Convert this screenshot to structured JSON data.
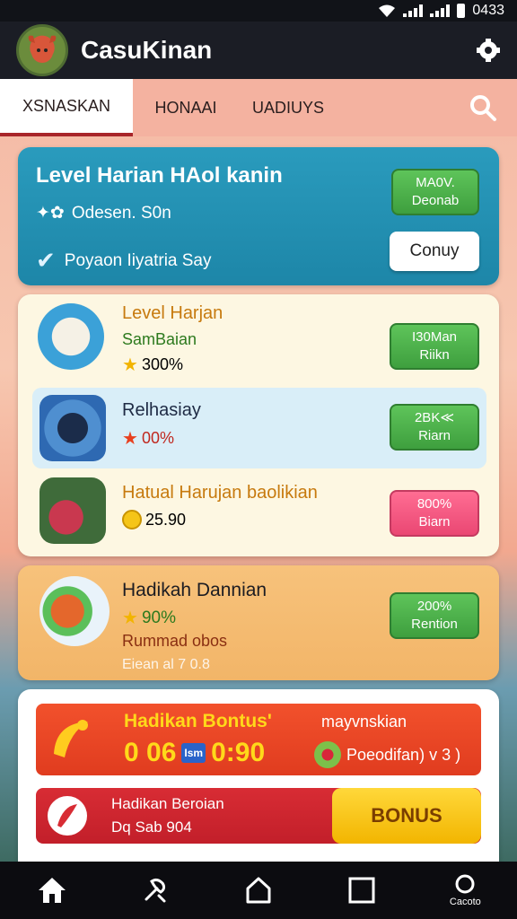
{
  "status_bar": {
    "time": "0433"
  },
  "app_bar": {
    "title": "CasuKinan",
    "avatar_icon": "crab-avatar",
    "settings_icon": "gear-icon"
  },
  "tabs": [
    {
      "label": "XSNASKAN",
      "active": true
    },
    {
      "label": "HONAAI",
      "active": false
    },
    {
      "label": "UADIUYS",
      "active": false
    }
  ],
  "hero": {
    "title": "Level Harian HAol kanin",
    "subtitle": "Odesen. S0n",
    "check_text": "Poyaon Iiyatria Say",
    "primary_button": {
      "line1": "MA0V.",
      "line2": "Deonab"
    },
    "secondary_button": "Conuy",
    "colors": {
      "background": "#1d86a8",
      "button_green": "#3e9f3e"
    }
  },
  "list_items": [
    {
      "title": "Level Harjan",
      "subtitle": "SamBaian",
      "stat": "300%",
      "stat_icon": "star-icon",
      "button": {
        "line1": "I30Man",
        "line2": "Riikn"
      },
      "button_color": "green",
      "highlighted": false
    },
    {
      "title": "Relhasiay",
      "subtitle": "",
      "stat": "00%",
      "stat_icon": "star-icon",
      "button": {
        "line1": "2BK≪",
        "line2": "Riarn"
      },
      "button_color": "green",
      "highlighted": true
    },
    {
      "title": "Hatual Harujan baolikian",
      "subtitle": "",
      "stat": "25.90",
      "stat_icon": "coin-icon",
      "button": {
        "line1": "800%",
        "line2": "Biarn"
      },
      "button_color": "pink",
      "highlighted": false
    }
  ],
  "feature_card": {
    "title": "Hadikah Dannian",
    "stat": "90%",
    "line1": "Rummad obos",
    "line2": "Eiean al 7 0.8",
    "button": {
      "line1": "200%",
      "line2": "Rention"
    }
  },
  "bonus": {
    "title": "Hadikan Bontus'",
    "timer_left": "0 06",
    "timer_mid": "Ism",
    "timer_right": "0:90",
    "right_title": "mayvnskian",
    "right_sub": "Poeodifan) v 3 )",
    "row2_title": "Hadikan Beroian",
    "row2_sub": "Dq Sab 904",
    "row2_button": "BONUS"
  },
  "nav": [
    {
      "icon": "home-icon",
      "label": ""
    },
    {
      "icon": "tools-icon",
      "label": ""
    },
    {
      "icon": "house-outline-icon",
      "label": ""
    },
    {
      "icon": "square-icon",
      "label": ""
    },
    {
      "icon": "profile-icon",
      "label": "Cacoto"
    }
  ]
}
